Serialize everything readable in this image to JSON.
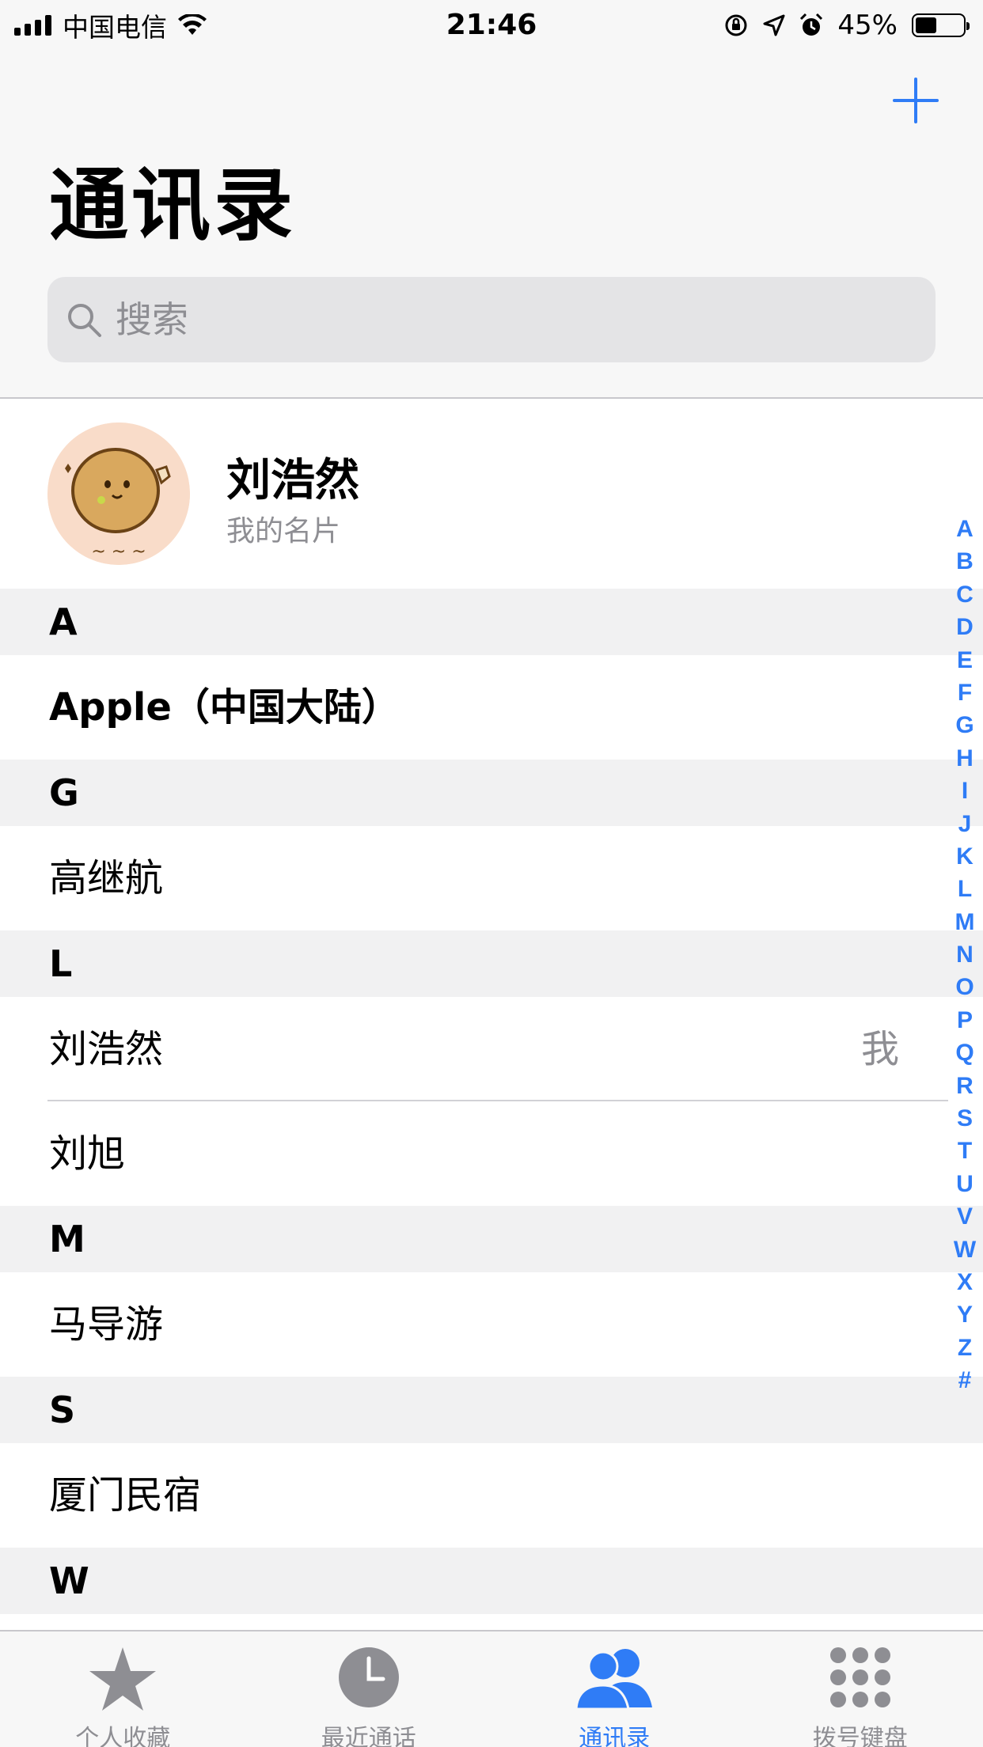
{
  "status_bar": {
    "carrier": "中国电信",
    "time": "21:46",
    "battery_percent": "45%",
    "battery_level": 0.45,
    "icons": [
      "signal-icon",
      "wifi-icon",
      "orientation-lock-icon",
      "location-icon",
      "alarm-icon",
      "battery-icon"
    ]
  },
  "header": {
    "title": "通讯录",
    "add_icon": "plus-icon"
  },
  "search": {
    "placeholder": "搜索",
    "value": ""
  },
  "my_card": {
    "name": "刘浩然",
    "subtitle": "我的名片"
  },
  "sections": [
    {
      "letter": "A",
      "contacts": [
        {
          "name": "Apple（中国大陆）",
          "bold": true
        }
      ]
    },
    {
      "letter": "G",
      "contacts": [
        {
          "name": "高继航"
        }
      ]
    },
    {
      "letter": "L",
      "contacts": [
        {
          "name": "刘浩然",
          "tag": "我"
        },
        {
          "name": "刘旭"
        }
      ]
    },
    {
      "letter": "M",
      "contacts": [
        {
          "name": "马导游"
        }
      ]
    },
    {
      "letter": "S",
      "contacts": [
        {
          "name": "厦门民宿"
        }
      ]
    },
    {
      "letter": "W",
      "contacts": []
    }
  ],
  "index_letters": [
    "A",
    "B",
    "C",
    "D",
    "E",
    "F",
    "G",
    "H",
    "I",
    "J",
    "K",
    "L",
    "M",
    "N",
    "O",
    "P",
    "Q",
    "R",
    "S",
    "T",
    "U",
    "V",
    "W",
    "X",
    "Y",
    "Z",
    "#"
  ],
  "tabs": [
    {
      "label": "个人收藏",
      "icon": "star-icon",
      "active": false
    },
    {
      "label": "最近通话",
      "icon": "clock-icon",
      "active": false
    },
    {
      "label": "通讯录",
      "icon": "contacts-icon",
      "active": true
    },
    {
      "label": "拨号键盘",
      "icon": "keypad-icon",
      "active": false
    }
  ],
  "colors": {
    "accent": "#2f7cf6",
    "inactive": "#8e8e93",
    "header_bg": "#f7f7f7",
    "section_bg": "#f1f1f2"
  }
}
